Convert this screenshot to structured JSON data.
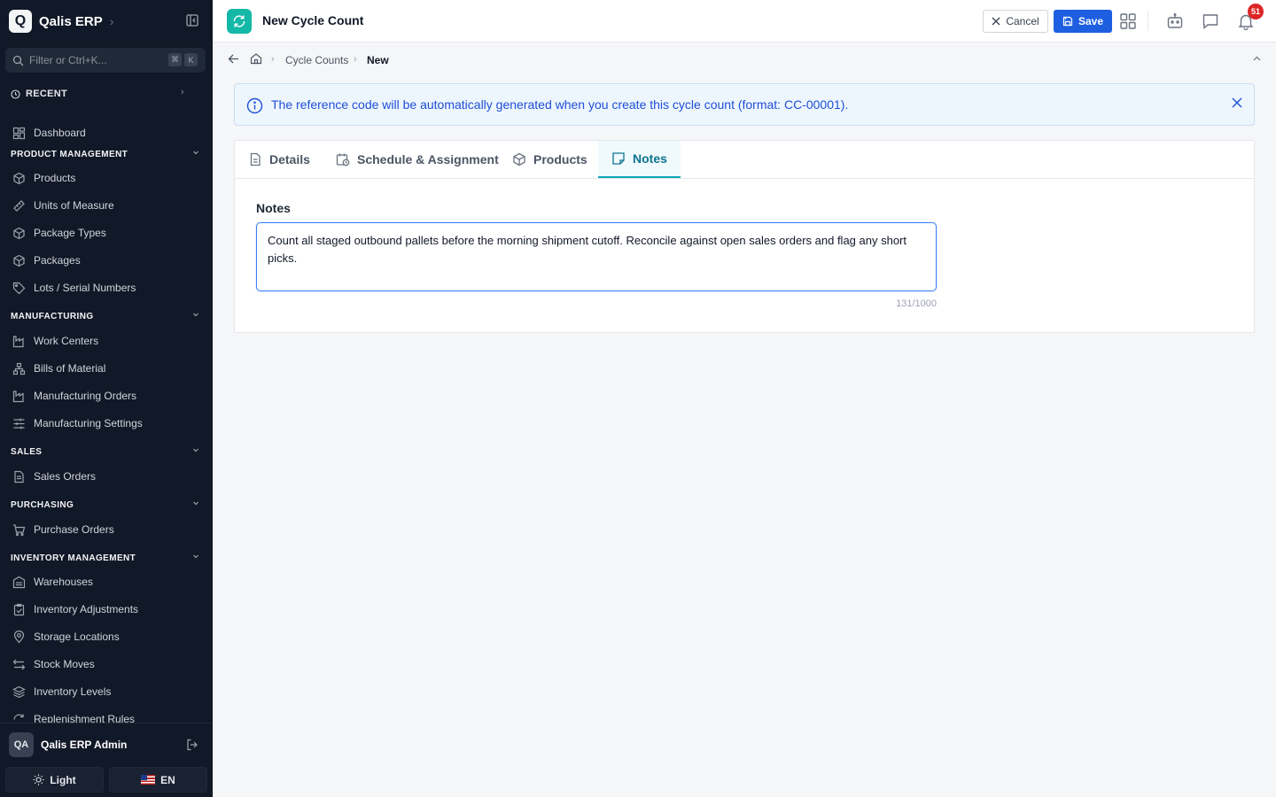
{
  "app": {
    "name": "Qalis ERP",
    "logo_letter": "Q"
  },
  "sidebar": {
    "filter_placeholder": "Filter or Ctrl+K...",
    "shortcut_keys": [
      "⌘",
      "K"
    ],
    "recent_label": "RECENT",
    "dashboard_label": "Dashboard",
    "sections": [
      {
        "title": "PRODUCT MANAGEMENT",
        "items": [
          "Products",
          "Units of Measure",
          "Package Types",
          "Packages",
          "Lots / Serial Numbers"
        ]
      },
      {
        "title": "MANUFACTURING",
        "items": [
          "Work Centers",
          "Bills of Material",
          "Manufacturing Orders",
          "Manufacturing Settings"
        ]
      },
      {
        "title": "SALES",
        "items": [
          "Sales Orders"
        ]
      },
      {
        "title": "PURCHASING",
        "items": [
          "Purchase Orders"
        ]
      },
      {
        "title": "INVENTORY MANAGEMENT",
        "items": [
          "Warehouses",
          "Inventory Adjustments",
          "Storage Locations",
          "Stock Moves",
          "Inventory Levels",
          "Replenishment Rules"
        ]
      }
    ],
    "user": {
      "initials": "QA",
      "name": "Qalis ERP Admin"
    },
    "theme_label": "Light",
    "language_label": "EN"
  },
  "header": {
    "title": "New Cycle Count",
    "cancel_label": "Cancel",
    "save_label": "Save",
    "notification_count": "51",
    "accent_color": "#14b8a6",
    "save_color": "#1d5fe0"
  },
  "breadcrumb": {
    "items": [
      "Cycle Counts",
      "New"
    ]
  },
  "banner": {
    "text": "The reference code will be automatically generated when you create this cycle count (format: CC-00001)."
  },
  "tabs": [
    "Details",
    "Schedule & Assignment",
    "Products",
    "Notes"
  ],
  "active_tab": "Notes",
  "notes": {
    "label": "Notes",
    "value": "Count all staged outbound pallets before the morning shipment cutoff. Reconcile against open sales orders and flag any short picks.",
    "counter": "131/1000"
  }
}
